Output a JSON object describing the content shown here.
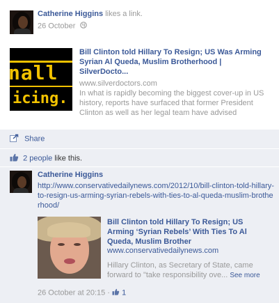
{
  "story": {
    "author": "Catherine Higgins",
    "action": "likes a link.",
    "date": "26 October",
    "privacy_icon": "globe-icon"
  },
  "share_card": {
    "thumb_text_top": "nall",
    "thumb_text_bottom": "icing.",
    "title": "Bill Clinton told Hillary To Resign; US Was Arming Syrian Al Queda, Muslim Brotherhood | SilverDocto...",
    "url": "www.silverdoctors.com",
    "description": "In what is rapidly becoming the biggest cover-up in US history, reports have surfaced that former President Clinton as well as her legal team have advised"
  },
  "ufi": {
    "share_label": "Share",
    "likes_link": "2 people",
    "likes_suffix": "like this."
  },
  "comment": {
    "author": "Catherine Higgins",
    "link_text": "http://www.conservativedailynews.com/2012/10/bill-clinton-told-hillary-to-resign-us-arming-syrian-rebels-with-ties-to-al-queda-muslim-brotherhood/",
    "card": {
      "title": "Bill Clinton told Hillary To Resign; US Arming ‘Syrian Rebels’ With Ties To Al Queda, Muslim Brother",
      "url": "www.conservativedailynews.com",
      "description": "Hillary Clinton, as Secretary of State, came forward to \"take responsibility ove...",
      "see_more": "See more"
    },
    "timestamp": "26 October at 20:15",
    "separator": "·",
    "like_count": "1"
  },
  "colors": {
    "link": "#3b5998",
    "muted": "#999999",
    "ufi_bg": "#edeff4",
    "thumb_bg": "#000000",
    "thumb_text": "#f2c200"
  }
}
